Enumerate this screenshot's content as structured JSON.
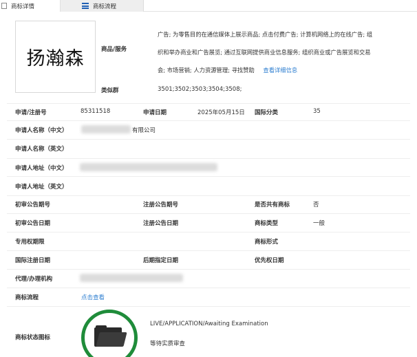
{
  "tabs": {
    "active": "商标详情",
    "inactive": "商标流程"
  },
  "logo": {
    "text": "扬瀚森"
  },
  "goods": {
    "label": "商品/服务",
    "line1": "广告; 为零售目的在通信媒体上展示商品; 点击付费广告; 计算机网络上的在线广告; 组",
    "line2": "织和举办商业和广告展览; 通过互联网提供商业信息服务; 组织商业或广告展览和交易",
    "line3": "会; 市场营销; 人力资源管理; 寻找赞助",
    "more_link": "查看详细信息"
  },
  "similar": {
    "label": "类似群",
    "value": "3501;3502;3503;3504;3508;"
  },
  "reg": {
    "label": "申请/注册号",
    "value": "85311518",
    "date_label": "申请日期",
    "date_value": "2025年05月15日",
    "class_label": "国际分类",
    "class_value": "35"
  },
  "applicant_cn": {
    "label": "申请人名称（中文）",
    "suffix": "有限公司"
  },
  "applicant_en": {
    "label": "申请人名称（英文）"
  },
  "address_cn": {
    "label": "申请人地址（中文）"
  },
  "address_en": {
    "label": "申请人地址（英文）"
  },
  "prelim_no": {
    "label": "初审公告期号",
    "reg_label": "注册公告期号",
    "shared_label": "是否共有商标",
    "shared_value": "否"
  },
  "prelim_date": {
    "label": "初审公告日期",
    "reg_label": "注册公告日期",
    "type_label": "商标类型",
    "type_value": "一般"
  },
  "exclusive": {
    "label": "专用权期限",
    "form_label": "商标形式"
  },
  "intl": {
    "label": "国际注册日期",
    "later_label": "后期指定日期",
    "priority_label": "优先权日期"
  },
  "agent": {
    "label": "代理/办理机构"
  },
  "process": {
    "label": "商标流程",
    "link": "点击查看"
  },
  "status": {
    "label": "商标状态图标",
    "en": "LIVE/APPLICATION/Awaiting Examination",
    "cn": "等待实质审查"
  },
  "colors": {
    "link": "#2f7fd0",
    "ring": "#1f8c3a",
    "tab_icon": "#1e5fb3"
  },
  "icons": {
    "tab_active": "document-icon",
    "tab_inactive": "list-icon",
    "status": "folder-icon"
  }
}
